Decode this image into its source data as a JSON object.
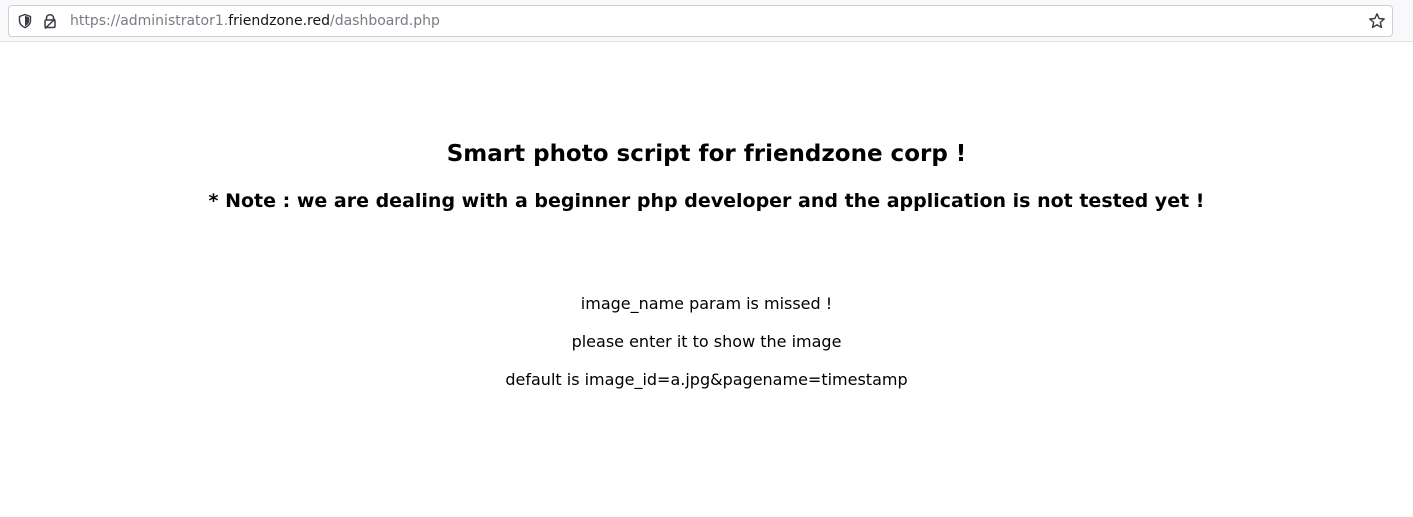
{
  "browser": {
    "url": {
      "scheme": "https://",
      "subdomain": "administrator1.",
      "host": "friendzone.red",
      "path": "/dashboard.php"
    },
    "icons": {
      "tracking_protection": "shield-icon",
      "connection": "lock-icon",
      "bookmark": "star-icon"
    }
  },
  "page": {
    "title": "Smart photo script for friendzone corp !",
    "note": "* Note : we are dealing with a beginner php developer and the application is not tested yet !",
    "messages": [
      "image_name param is missed !",
      "please enter it to show the image",
      "default is image_id=a.jpg&pagename=timestamp"
    ]
  }
}
